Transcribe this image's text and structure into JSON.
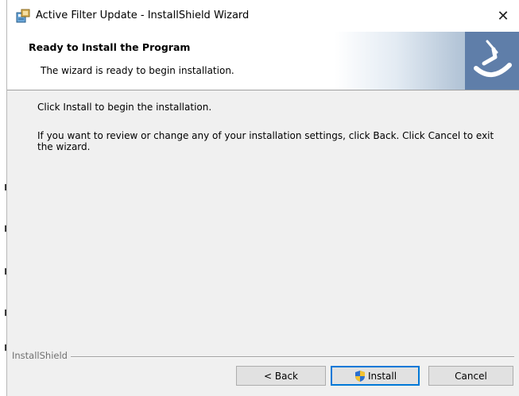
{
  "window": {
    "title": "Active Filter Update - InstallShield Wizard",
    "close_glyph": "✕"
  },
  "banner": {
    "title": "Ready to Install the Program",
    "subtitle": "The wizard is ready to begin installation."
  },
  "body": {
    "line1": "Click Install to begin the installation.",
    "line2": "If you want to review or change any of your installation settings, click Back. Click Cancel to exit the wizard."
  },
  "footer": {
    "brand": "InstallShield",
    "back_label": "< Back",
    "install_label": "Install",
    "cancel_label": "Cancel"
  },
  "icons": {
    "app": "installer-icon",
    "logo": "installshield-logo-icon",
    "shield": "uac-shield-icon"
  },
  "colors": {
    "accent": "#0078d7",
    "logo_bg": "#5f7ea9",
    "button_bg": "#e1e1e1",
    "window_bg": "#f0f0f0"
  }
}
